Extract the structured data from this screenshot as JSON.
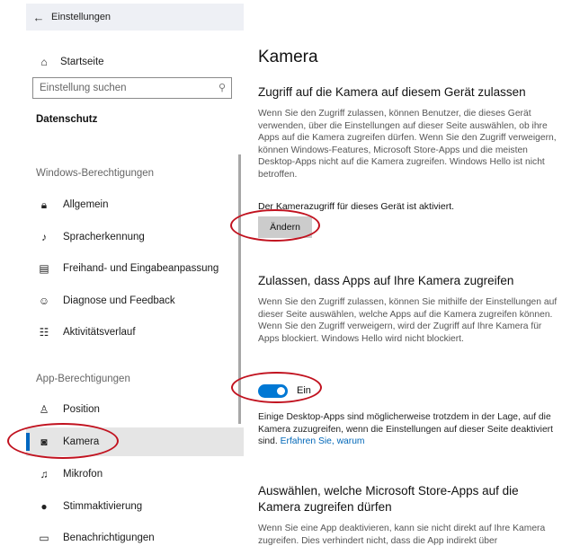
{
  "window": {
    "title": "Einstellungen",
    "back_icon": "back-arrow-icon"
  },
  "sidebar": {
    "home_label": "Startseite",
    "search_placeholder": "Einstellung suchen",
    "category_title": "Datenschutz",
    "section_windows": "Windows-Berechtigungen",
    "section_apps": "App-Berechtigungen",
    "windows_items": [
      {
        "label": "Allgemein",
        "icon": "lock-icon"
      },
      {
        "label": "Spracherkennung",
        "icon": "speech-icon"
      },
      {
        "label": "Freihand- und Eingabeanpassung",
        "icon": "clipboard-icon"
      },
      {
        "label": "Diagnose und Feedback",
        "icon": "feedback-icon"
      },
      {
        "label": "Aktivitätsverlauf",
        "icon": "timeline-icon"
      }
    ],
    "app_items": [
      {
        "label": "Position",
        "icon": "location-icon"
      },
      {
        "label": "Kamera",
        "icon": "camera-icon",
        "active": true
      },
      {
        "label": "Mikrofon",
        "icon": "microphone-icon"
      },
      {
        "label": "Stimmaktivierung",
        "icon": "voice-activation-icon"
      },
      {
        "label": "Benachrichtigungen",
        "icon": "notification-icon"
      }
    ]
  },
  "main": {
    "title": "Kamera",
    "section1": {
      "heading": "Zugriff auf die Kamera auf diesem Gerät zulassen",
      "description": "Wenn Sie den Zugriff zulassen, können Benutzer, die dieses Gerät verwenden, über die Einstellungen auf dieser Seite auswählen, ob ihre Apps auf die Kamera zugreifen dürfen. Wenn Sie den Zugriff verweigern, können Windows-Features, Microsoft Store-Apps und die meisten Desktop-Apps nicht auf die Kamera zugreifen. Windows Hello ist nicht betroffen.",
      "status": "Der Kamerazugriff für dieses Gerät ist aktiviert.",
      "button_label": "Ändern"
    },
    "section2": {
      "heading": "Zulassen, dass Apps auf Ihre Kamera zugreifen",
      "description": "Wenn Sie den Zugriff zulassen, können Sie mithilfe der Einstellungen auf dieser Seite auswählen, welche Apps auf die Kamera zugreifen können. Wenn Sie den Zugriff verweigern, wird der Zugriff auf Ihre Kamera für Apps blockiert. Windows Hello wird nicht blockiert.",
      "toggle_state": "Ein",
      "toggle_on": true,
      "note": "Einige Desktop-Apps sind möglicherweise trotzdem in der Lage, auf die Kamera zuzugreifen, wenn die Einstellungen auf dieser Seite deaktiviert sind.",
      "note_link": "Erfahren Sie, warum"
    },
    "section3": {
      "heading": "Auswählen, welche Microsoft Store-Apps auf die Kamera zugreifen dürfen",
      "description": "Wenn Sie eine App deaktivieren, kann sie nicht direkt auf Ihre Kamera zugreifen. Dies verhindert nicht, dass die App indirekt über"
    }
  },
  "colors": {
    "accent": "#0078d4",
    "link": "#0067b8",
    "annotation": "#c1121f"
  }
}
